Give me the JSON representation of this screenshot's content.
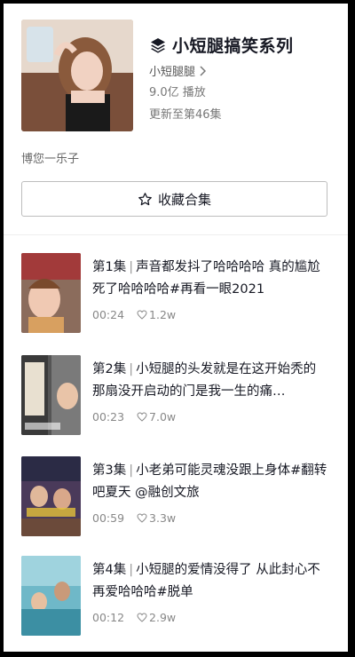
{
  "collection": {
    "title": "小短腿搞笑系列",
    "author": "小短腿腿",
    "plays": "9.0亿 播放",
    "updated": "更新至第46集",
    "description": "博您一乐子",
    "favorite_label": "收藏合集"
  },
  "icons": {
    "title_icon": "layers-icon",
    "author_icon": "chevron-right-icon",
    "favorite_icon": "star-outline-icon",
    "like_icon": "heart-outline-icon"
  },
  "colors": {
    "text": "#161823",
    "secondary": "#777777",
    "border": "#bdbdbd"
  },
  "episodes": [
    {
      "ep": "第1集",
      "title": "声音都发抖了哈哈哈哈 真的尴尬死了哈哈哈哈#再看一眼2021",
      "duration": "00:24",
      "likes": "1.2w"
    },
    {
      "ep": "第2集",
      "title": "小短腿的头发就是在这开始秃的 那扇没开启动的门是我一生的痛…",
      "duration": "00:23",
      "likes": "7.0w"
    },
    {
      "ep": "第3集",
      "title": "小老弟可能灵魂没跟上身体#翻转吧夏天 @融创文旅",
      "duration": "00:59",
      "likes": "3.3w"
    },
    {
      "ep": "第4集",
      "title": "小短腿的爱情没得了 从此封心不再爱哈哈哈#脱单",
      "duration": "00:12",
      "likes": "2.9w"
    }
  ]
}
